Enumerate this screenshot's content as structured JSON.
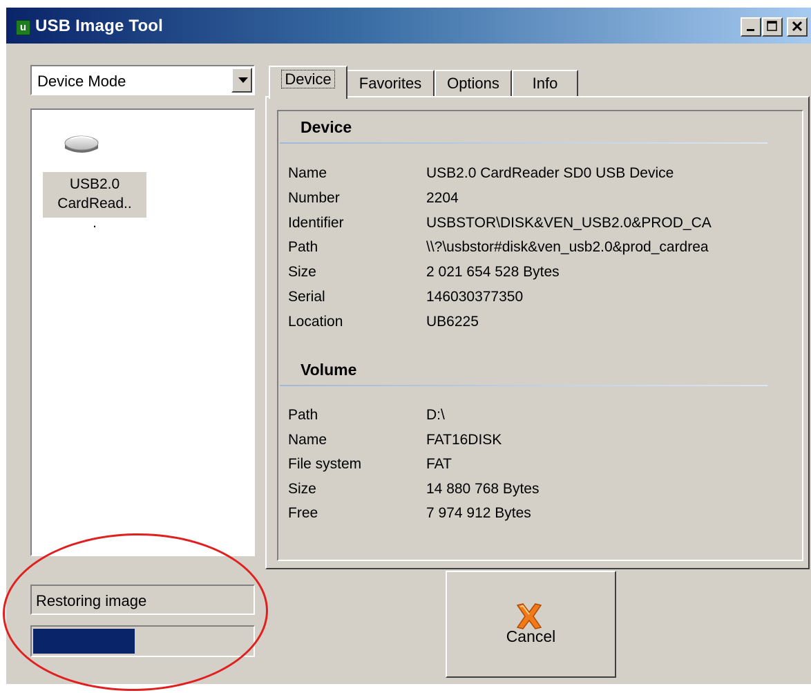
{
  "window": {
    "title": "USB Image Tool"
  },
  "mode_select": {
    "value": "Device Mode"
  },
  "device_list": [
    {
      "label": "USB2.0 CardRead..."
    }
  ],
  "tabs": [
    {
      "label": "Device",
      "active": true
    },
    {
      "label": "Favorites",
      "active": false
    },
    {
      "label": "Options",
      "active": false
    },
    {
      "label": "Info",
      "active": false
    }
  ],
  "device_section": {
    "title": "Device",
    "props": [
      {
        "key": "Name",
        "value": "USB2.0 CardReader SD0 USB Device"
      },
      {
        "key": "Number",
        "value": "2204"
      },
      {
        "key": "Identifier",
        "value": "USBSTOR\\DISK&VEN_USB2.0&PROD_CA"
      },
      {
        "key": "Path",
        "value": "\\\\?\\usbstor#disk&ven_usb2.0&prod_cardrea"
      },
      {
        "key": "Size",
        "value": "2 021 654 528 Bytes"
      },
      {
        "key": "Serial",
        "value": "146030377350"
      },
      {
        "key": "Location",
        "value": "UB6225"
      }
    ]
  },
  "volume_section": {
    "title": "Volume",
    "props": [
      {
        "key": "Path",
        "value": "D:\\"
      },
      {
        "key": "Name",
        "value": "FAT16DISK"
      },
      {
        "key": "File system",
        "value": "FAT"
      },
      {
        "key": "Size",
        "value": "14 880 768 Bytes"
      },
      {
        "key": "Free",
        "value": "7 974 912 Bytes"
      }
    ]
  },
  "status": {
    "text": "Restoring image"
  },
  "progress": {
    "fraction": 0.46
  },
  "cancel": {
    "label": "Cancel"
  },
  "colors": {
    "titlebar": "#0a246a",
    "face": "#d4d0c8",
    "progress": "#0a246a",
    "annotation": "#e0201f"
  }
}
